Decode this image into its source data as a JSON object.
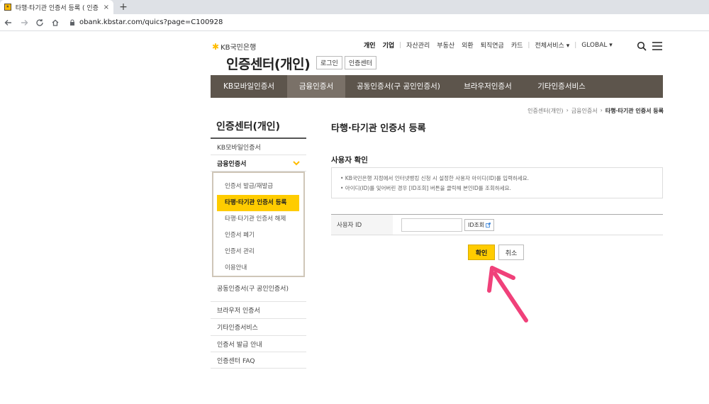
{
  "browser": {
    "tab_title": "타행·타기관 인증서 등록 ( 인증 :",
    "tab_close": "×",
    "new_tab": "+",
    "url": "obank.kbstar.com/quics?page=C100928"
  },
  "header": {
    "logo_text": "KB국민은행",
    "site_title": "인증센터(개인)",
    "buttons": [
      "로그인",
      "인증센터"
    ],
    "top_menu": [
      "개인",
      "기업",
      "자산관리",
      "부동산",
      "외환",
      "퇴직연금",
      "카드",
      "전체서비스 ▾",
      "GLOBAL ▾"
    ]
  },
  "gnb": [
    "KB모바일인증서",
    "금융인증서",
    "공동인증서(구 공인인증서)",
    "브라우저인증서",
    "기타인증서비스"
  ],
  "gnb_active_index": 1,
  "breadcrumb": [
    "인증센터(개인)",
    "금융인증서",
    "타행·타기관 인증서 등록"
  ],
  "lnb": {
    "title": "인증센터(개인)",
    "items_before": [
      "KB모바일인증서"
    ],
    "open_item": "금융인증서",
    "sub_items": [
      "인증서 발급/재발급",
      "타행·타기관 인증서 등록",
      "타행·타기관 인증서 해제",
      "인증서 폐기",
      "인증서 관리",
      "이용안내"
    ],
    "sub_active_index": 1,
    "items_after": [
      "공동인증서(구 공인인증서)",
      "브라우저 인증서",
      "기타인증서비스",
      "인증서 발급 안내",
      "인증센터 FAQ"
    ]
  },
  "content": {
    "page_title": "타행·타기관 인증서 등록",
    "section_title": "사용자 확인",
    "info_lines": [
      "• KB국민은행 지정에서 인터넷뱅킹 신청 시 설정한 사용자 아이디(ID)를 입력하세요.",
      "• 아이디(ID)를 잊어버린 경우 [ID조회] 버튼을 클릭해 본인ID를 조회하세요."
    ],
    "user_id_label": "사용자 ID",
    "user_id_value": "",
    "id_lookup_button": "ID조회",
    "ok_button": "확인",
    "cancel_button": "취소"
  },
  "colors": {
    "kb_yellow": "#ffcc00",
    "gnb_bg": "#5d554c",
    "annotation_arrow": "#f0417a"
  }
}
